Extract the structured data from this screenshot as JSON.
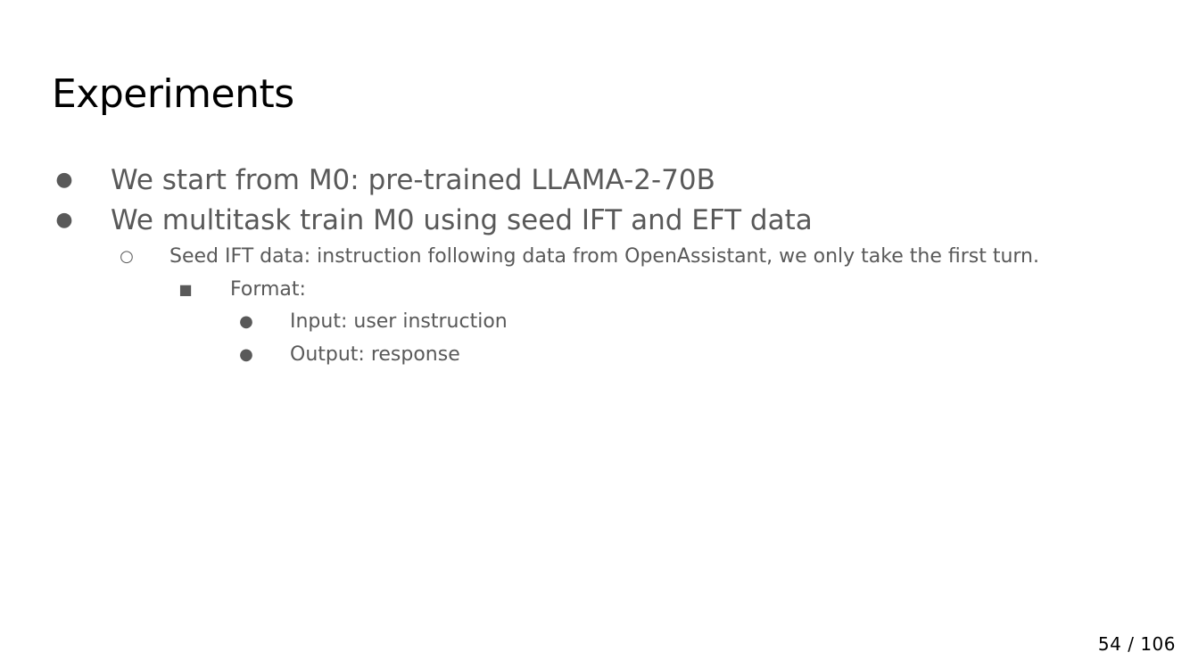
{
  "slide": {
    "title": "Experiments",
    "bullets": [
      {
        "level": 1,
        "marker": "●",
        "text": "We start from M0: pre-trained LLAMA-2-70B"
      },
      {
        "level": 1,
        "marker": "●",
        "text": "We multitask train M0 using seed IFT and EFT data"
      },
      {
        "level": 2,
        "marker": "○",
        "text": "Seed IFT data: instruction following data from OpenAssistant, we only take the first turn."
      },
      {
        "level": 3,
        "marker": "■",
        "text": "Format:"
      },
      {
        "level": 4,
        "marker": "●",
        "text": "Input: user instruction"
      },
      {
        "level": 4,
        "marker": "●",
        "text": "Output: response"
      }
    ]
  },
  "pager": {
    "label": "54 / 106"
  }
}
